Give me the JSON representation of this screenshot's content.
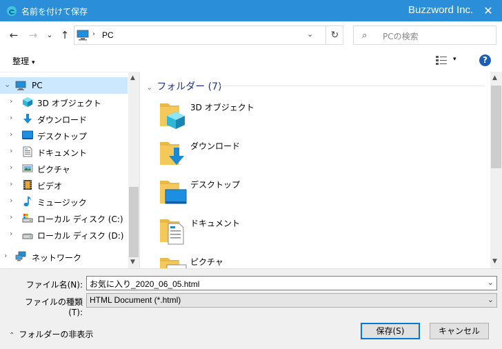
{
  "window": {
    "title": "名前を付けて保存",
    "brand": "Buzzword Inc.",
    "close_glyph": "✕"
  },
  "navbar": {
    "back_glyph": "←",
    "forward_glyph": "→",
    "recent_glyph": "⌄",
    "up_glyph": "↑",
    "address": {
      "separator": "›",
      "path": "PC",
      "dropdown_glyph": "⌄",
      "refresh_glyph": "↻"
    },
    "search": {
      "icon_glyph": "⌕",
      "placeholder": "PCの検索"
    }
  },
  "commandbar": {
    "organize_label": "整理",
    "organize_caret": "▾",
    "view_caret": "▾",
    "help_label": "?"
  },
  "sidebar": {
    "items": [
      {
        "label": "PC",
        "icon": "pc-icon",
        "chevron": "⌄"
      },
      {
        "label": "3D オブジェクト",
        "icon": "3d-objects-icon",
        "chevron": "›"
      },
      {
        "label": "ダウンロード",
        "icon": "download-icon",
        "chevron": "›"
      },
      {
        "label": "デスクトップ",
        "icon": "desktop-icon",
        "chevron": "›"
      },
      {
        "label": "ドキュメント",
        "icon": "document-icon",
        "chevron": "›"
      },
      {
        "label": "ピクチャ",
        "icon": "picture-icon",
        "chevron": "›"
      },
      {
        "label": "ビデオ",
        "icon": "video-icon",
        "chevron": "›"
      },
      {
        "label": "ミュージック",
        "icon": "music-icon",
        "chevron": "›"
      },
      {
        "label": "ローカル ディスク (C:)",
        "icon": "drive-c-icon",
        "chevron": "›"
      },
      {
        "label": "ローカル ディスク (D:)",
        "icon": "drive-d-icon",
        "chevron": "›"
      },
      {
        "label": "ネットワーク",
        "icon": "network-icon",
        "chevron": "›"
      }
    ],
    "scroll_up": "▲",
    "scroll_down": "▼"
  },
  "content": {
    "group_caret": "⌄",
    "group_header": "フォルダー (7)",
    "folders": [
      {
        "name": "3D オブジェクト",
        "icon": "3d-objects-folder-icon"
      },
      {
        "name": "ダウンロード",
        "icon": "download-folder-icon"
      },
      {
        "name": "デスクトップ",
        "icon": "desktop-folder-icon"
      },
      {
        "name": "ドキュメント",
        "icon": "document-folder-icon"
      },
      {
        "name": "ピクチャ",
        "icon": "picture-folder-icon"
      }
    ],
    "scroll_up": "▲",
    "scroll_down": "▼"
  },
  "form": {
    "filename_label": "ファイル名(N):",
    "filename_value": "お気に入り_2020_06_05.html",
    "filetype_label": "ファイルの種類(T):",
    "filetype_value": "HTML Document (*.html)",
    "dropdown_glyph": "⌄"
  },
  "footer": {
    "hide_folders_caret": "⌃",
    "hide_folders_label": "フォルダーの非表示",
    "save_label": "保存(S)",
    "cancel_label": "キャンセル"
  },
  "colors": {
    "titlebar": "#2b8ed8",
    "selection": "#cce8ff",
    "folder": "#f5c85a",
    "accent_blue": "#1a8ad4"
  }
}
